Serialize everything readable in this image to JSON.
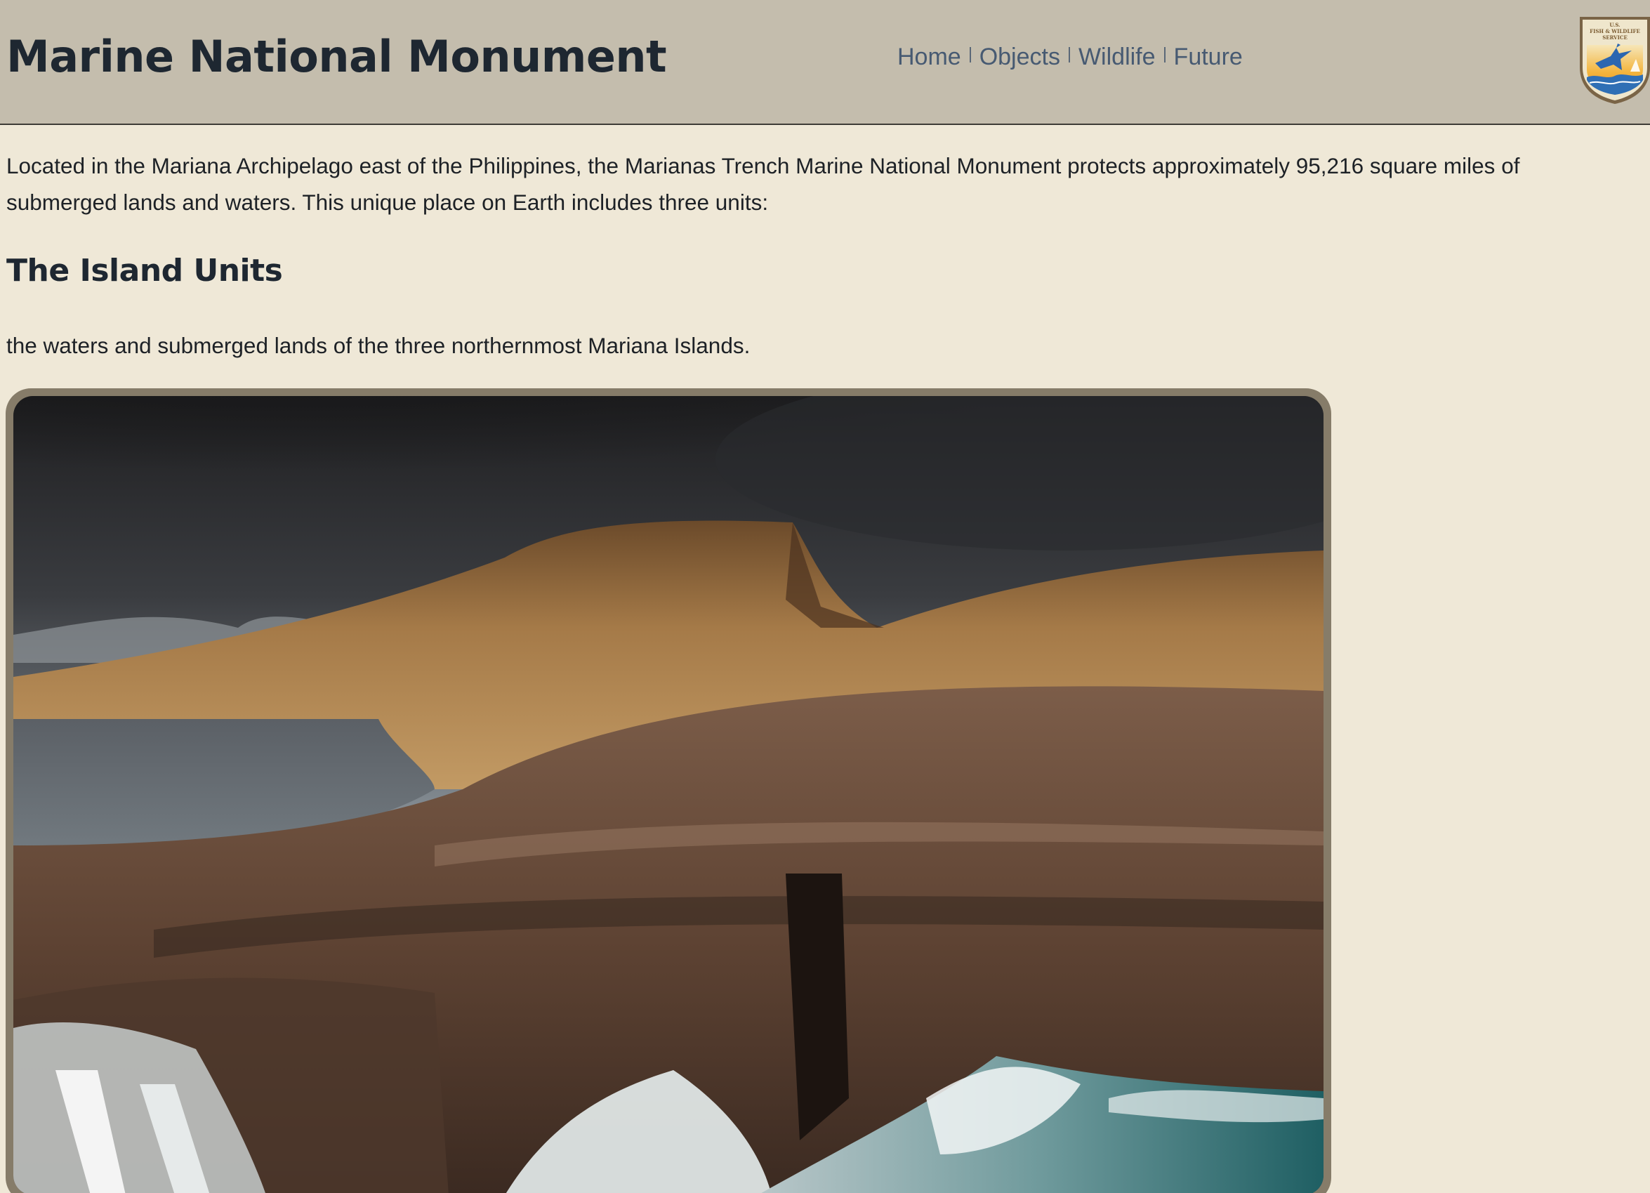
{
  "header": {
    "title": "Marine National Monument",
    "nav": [
      {
        "label": "Home"
      },
      {
        "label": "Objects"
      },
      {
        "label": "Wildlife"
      },
      {
        "label": "Future"
      }
    ],
    "logo": {
      "icon": "usfws-shield-icon",
      "text_lines": [
        "U.S.",
        "FISH & WILDLIFE",
        "SERVICE"
      ]
    }
  },
  "main": {
    "intro": "Located in the Mariana Archipelago east of the Philippines, the Marianas Trench Marine National Monument protects approximately 95,216 square miles of submerged lands and waters. This unique place on Earth includes three units:",
    "section": {
      "heading": "The Island Units",
      "description": "the waters and submerged lands of the three northernmost Mariana Islands."
    },
    "photo": {
      "subject": "coastal-cliff-waterfall-photo"
    }
  },
  "colors": {
    "page_background": "#efe8d7",
    "header_background": "#c4bdad",
    "nav_link": "#475a72",
    "title_text": "#1e2731",
    "photo_frame": "#867c69"
  }
}
